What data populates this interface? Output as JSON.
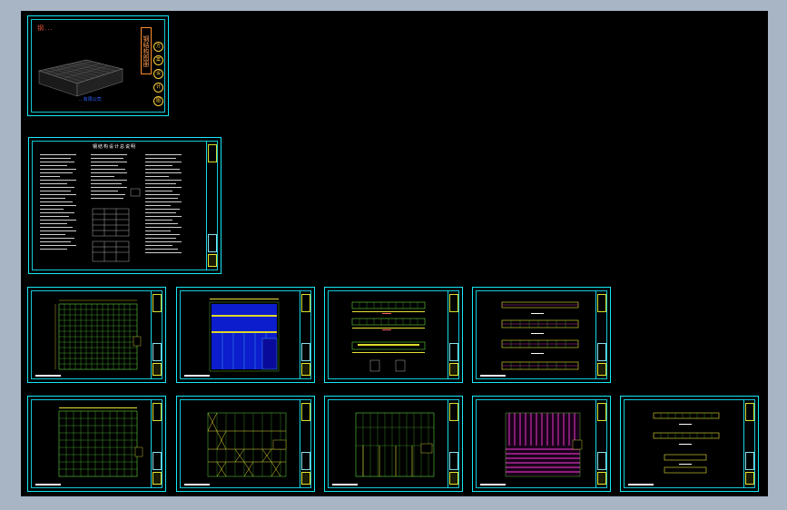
{
  "app": {
    "viewport_bg": "#000000",
    "frame_color": "#17e8f6"
  },
  "cover": {
    "title": "钢...",
    "company": "...有限公司",
    "subtitle": "...",
    "vertical_title": "钢结构图册",
    "stamps": [
      "方",
      "案",
      "设",
      "计",
      "图"
    ]
  },
  "notes_sheet": {
    "title": "钢结构设计总说明"
  },
  "sheets": [
    {
      "id": "cover",
      "kind": "cover"
    },
    {
      "id": "notes",
      "kind": "notes"
    },
    {
      "id": "plan-1",
      "kind": "grid-plan"
    },
    {
      "id": "plan-2",
      "kind": "blue-roof"
    },
    {
      "id": "elev-1",
      "kind": "elevations"
    },
    {
      "id": "elev-2",
      "kind": "elevations-2"
    },
    {
      "id": "plan-3",
      "kind": "grid-plan"
    },
    {
      "id": "plan-4",
      "kind": "yellow-frame"
    },
    {
      "id": "plan-5",
      "kind": "frame-plan"
    },
    {
      "id": "plan-6",
      "kind": "magenta-roof"
    },
    {
      "id": "elev-3",
      "kind": "elevations-3"
    }
  ]
}
